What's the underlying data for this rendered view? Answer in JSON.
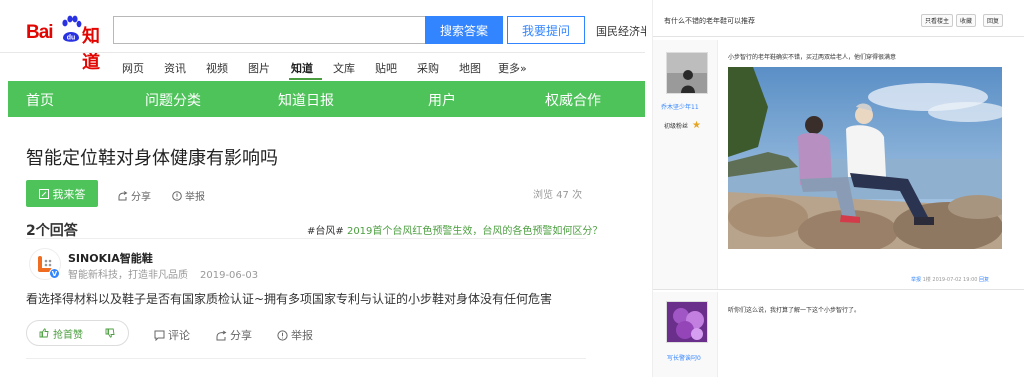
{
  "header": {
    "logo_bai": "Bai",
    "logo_du": "du",
    "logo_zhidao": "知道",
    "search_button": "搜索答案",
    "ask_button": "我要提问",
    "econ_link": "国民经济半",
    "search_value": ""
  },
  "nav": {
    "items": [
      "网页",
      "资讯",
      "视频",
      "图片",
      "知道",
      "文库",
      "贴吧",
      "采购",
      "地图",
      "更多»"
    ]
  },
  "greenbar": {
    "items": [
      "首页",
      "问题分类",
      "知道日报",
      "用户",
      "权威合作"
    ]
  },
  "question": {
    "title": "智能定位鞋对身体健康有影响吗",
    "answer_button": "我来答",
    "share": "分享",
    "report": "举报",
    "views": "浏览 47 次"
  },
  "answers": {
    "count_label": "2个回答",
    "topic_tag": "#台风#",
    "topic_text": "2019首个台风红色预警生效，台风的各色预警如何区分？"
  },
  "answer": {
    "author": "SINOKIA智能鞋",
    "subtitle": "智能新科技，打造非凡品质",
    "date": "2019-06-03",
    "content": "看选择得材料以及鞋子是否有国家质检认证~拥有多项国家专利与认证的小步鞋对身体没有任何危害",
    "like_label": "抢首赞",
    "comment": "评论",
    "share": "分享",
    "report": "举报"
  },
  "right_panel": {
    "question": "有什么不错的老年鞋可以推荐",
    "buttons": [
      "只看楼主",
      "收藏",
      "回复"
    ],
    "post1": {
      "user": "乔木坚少年11",
      "level": "初级粉丝",
      "text": "小步智行的老年鞋确实不错，买过两双给老人，他们穿得很满意",
      "footer_report": "举报",
      "footer_floor": "1楼",
      "footer_date": "2019-07-02 19:00",
      "footer_reply": "回复"
    },
    "post2": {
      "user": "写长警诶叼0",
      "text": "听你们这么说，我打算了解一下这个小步智行了。"
    }
  },
  "colors": {
    "green": "#4dc35a",
    "blue": "#3385ff",
    "baidu_red": "#e10602"
  },
  "icons": [
    "paw-icon",
    "edit-icon",
    "share-icon",
    "report-icon",
    "thumbs-up-icon",
    "thumbs-down-icon",
    "comment-icon",
    "star-icon",
    "verified-icon"
  ]
}
